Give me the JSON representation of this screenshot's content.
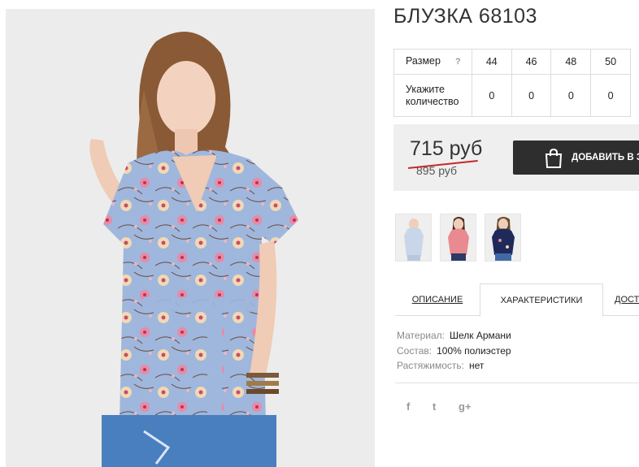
{
  "product": {
    "title": "БЛУЗКА 68103",
    "image_alt": "Женщина в голубой блузке с цветочным принтом"
  },
  "size_table": {
    "size_label": "Размер",
    "help_icon": "?",
    "sizes": [
      "44",
      "46",
      "48",
      "50"
    ],
    "quantity_label_line1": "Укажите",
    "quantity_label_line2": "количество",
    "quantities": [
      "0",
      "0",
      "0",
      "0"
    ]
  },
  "price": {
    "current": "715 руб",
    "old": "895 руб"
  },
  "cart": {
    "button_label": "ДОБАВИТЬ В ЗАКАЗ",
    "icon": "shopping-bag-icon"
  },
  "thumbnails": [
    {
      "name": "thumbnail-light-blue",
      "color": "#c9d6ea"
    },
    {
      "name": "thumbnail-pink",
      "color": "#e98a90"
    },
    {
      "name": "thumbnail-navy",
      "color": "#1f2a5a"
    }
  ],
  "tabs": [
    {
      "label": "ОПИСАНИЕ",
      "active": false
    },
    {
      "label": "ХАРАКТЕРИСТИКИ",
      "active": true
    },
    {
      "label": "ДОСТАВКА",
      "active": false
    }
  ],
  "specs": [
    {
      "key": "Материал:",
      "value": "Шелк Армани"
    },
    {
      "key": "Состав:",
      "value": "100% полиэстер"
    },
    {
      "key": "Растяжимость:",
      "value": "нет"
    }
  ],
  "social": {
    "facebook": "f",
    "twitter": "t",
    "google_plus": "g+"
  },
  "colors": {
    "accent_dark": "#2e2e2e",
    "old_price_strike": "#c62828",
    "blouse_blue": "#9fb7dc"
  }
}
